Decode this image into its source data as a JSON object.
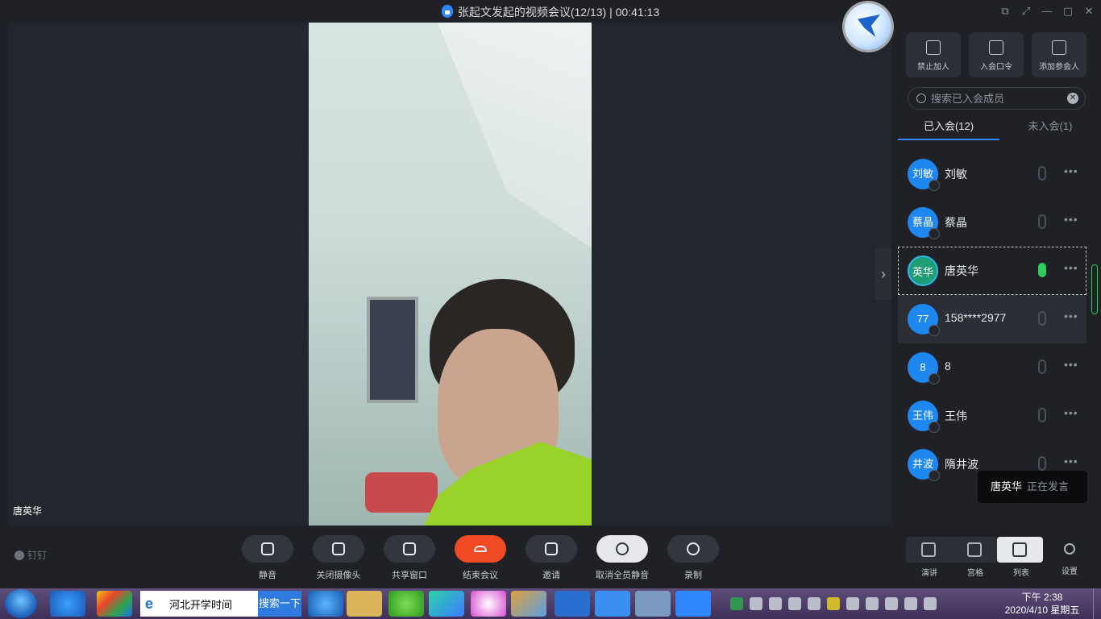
{
  "window": {
    "title": "张起文发起的视频会议(12/13) | 00:41:13"
  },
  "stage": {
    "speaker_name": "唐英华"
  },
  "panel": {
    "actions": [
      {
        "label": "禁止加人",
        "icon": "lock-icon"
      },
      {
        "label": "入会口令",
        "icon": "share-icon"
      },
      {
        "label": "添加参会人",
        "icon": "add-user-icon"
      }
    ],
    "search_placeholder": "搜索已入会成员",
    "tabs": [
      {
        "label": "已入会(12)",
        "active": true
      },
      {
        "label": "未入会(1)",
        "active": false
      }
    ],
    "members": [
      {
        "avatar": "刘敏",
        "name": "刘敏",
        "mic_on": false
      },
      {
        "avatar": "蔡晶",
        "name": "蔡晶",
        "mic_on": false
      },
      {
        "avatar": "英华",
        "name": "唐英华",
        "mic_on": true
      },
      {
        "avatar": "77",
        "name": "158****2977",
        "mic_on": false
      },
      {
        "avatar": "8",
        "name": "8",
        "mic_on": false
      },
      {
        "avatar": "王伟",
        "name": "王伟",
        "mic_on": false
      },
      {
        "avatar": "井波",
        "name": "隋井波",
        "mic_on": false
      }
    ],
    "speaking_toast": {
      "name": "唐英华",
      "status": "正在发言"
    }
  },
  "toolbar": {
    "brand": "钉钉",
    "buttons": [
      {
        "label": "静音",
        "icon": "microphone-icon"
      },
      {
        "label": "关闭摄像头",
        "icon": "camera-icon"
      },
      {
        "label": "共享窗口",
        "icon": "screen-share-icon"
      },
      {
        "label": "结束会议",
        "icon": "hang-up-icon"
      },
      {
        "label": "邀请",
        "icon": "invite-icon"
      },
      {
        "label": "取消全员静音",
        "icon": "unmute-all-icon"
      },
      {
        "label": "录制",
        "icon": "record-icon"
      }
    ],
    "layouts": [
      {
        "label": "演讲",
        "active": false
      },
      {
        "label": "宫格",
        "active": false
      },
      {
        "label": "列表",
        "active": true
      }
    ],
    "settings_label": "设置"
  },
  "taskbar": {
    "search_value": "河北开学时间",
    "search_button": "搜索一下",
    "clock_time": "下午 2:38",
    "clock_date": "2020/4/10 星期五"
  },
  "colors": {
    "accent": "#2f87ff",
    "end_call": "#f04a24",
    "mic_active": "#2ecc5a"
  }
}
